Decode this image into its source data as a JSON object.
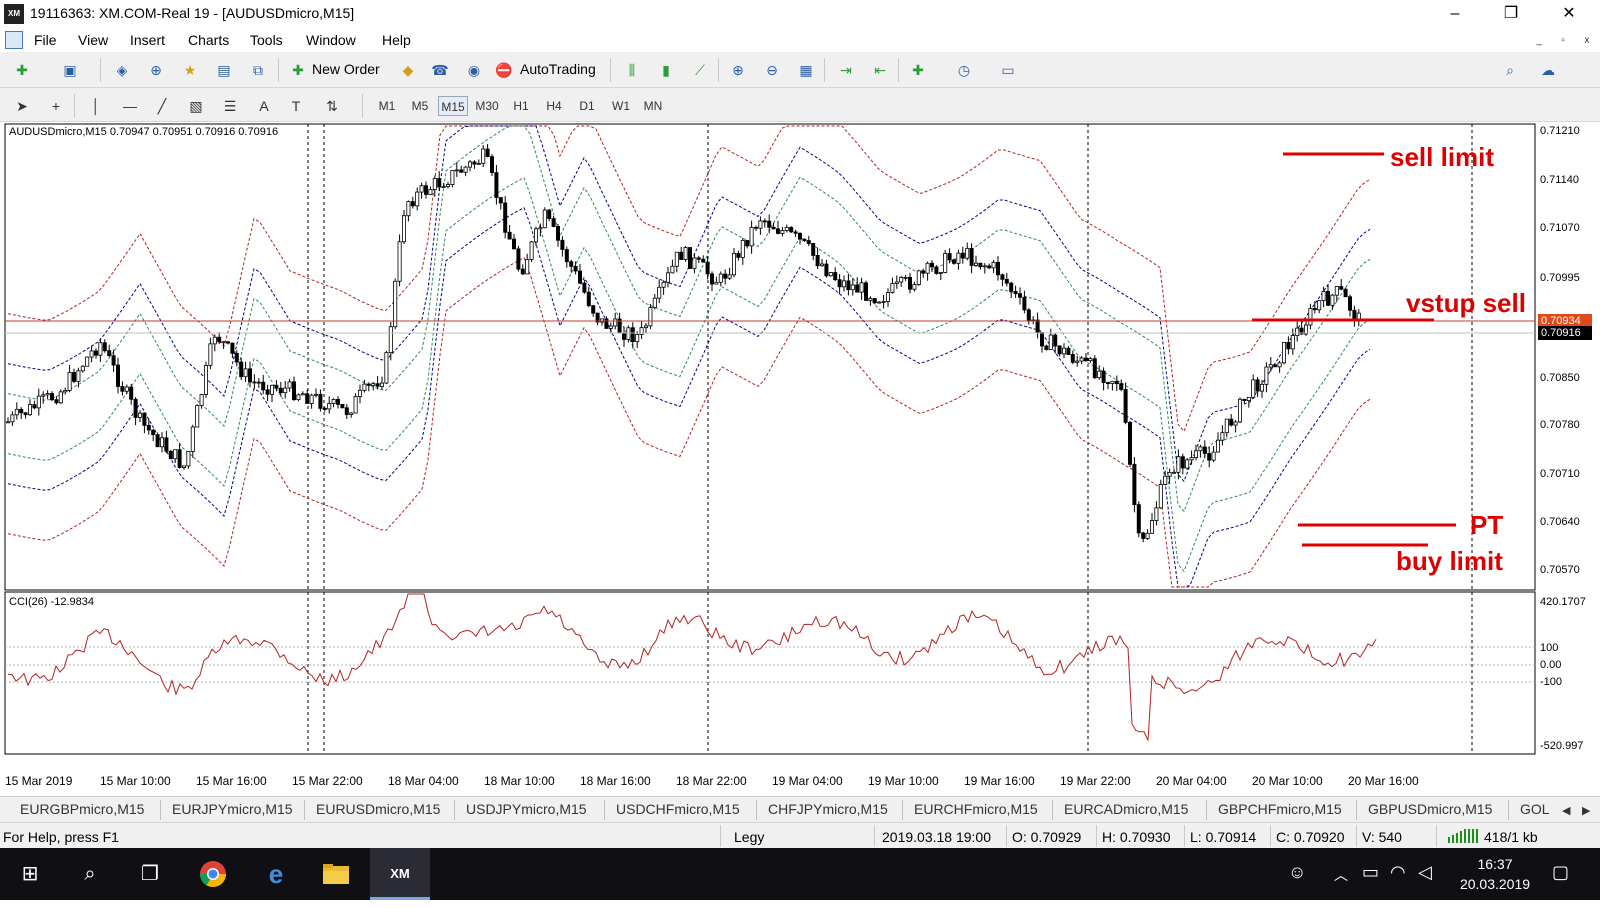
{
  "window": {
    "title": "19116363: XM.COM-Real 19 - [AUDUSDmicro,M15]",
    "app_logo": "XM",
    "controls": {
      "minimize": "–",
      "maximize": "❐",
      "close": "✕"
    }
  },
  "menu": {
    "items": [
      "File",
      "View",
      "Insert",
      "Charts",
      "Tools",
      "Window",
      "Help"
    ],
    "mdi_controls": {
      "minimize": "_",
      "restore": "▫",
      "close": "x"
    }
  },
  "toolbar": {
    "new_order_label": "New Order",
    "autotrading_label": "AutoTrading",
    "timeframes": [
      "M1",
      "M5",
      "M15",
      "M30",
      "H1",
      "H4",
      "D1",
      "W1",
      "MN"
    ],
    "active_timeframe": "M15",
    "text_tool_label": "A"
  },
  "chart": {
    "info_line": "AUDUSDmicro,M15  0.70947 0.70951 0.70916 0.70916",
    "cci_info": "CCI(26) -12.9834",
    "price_axis": [
      "0.71210",
      "0.71140",
      "0.71070",
      "0.70995",
      "0.70850",
      "0.70780",
      "0.70710",
      "0.70640",
      "0.70570"
    ],
    "current_price": "0.70916",
    "red_line_price": "0.70934",
    "cci_axis": [
      "420.1707",
      "100",
      "0.00",
      "-100",
      "-520.997"
    ],
    "time_axis": [
      "15 Mar 2019",
      "15 Mar 10:00",
      "15 Mar 16:00",
      "15 Mar 22:00",
      "18 Mar 04:00",
      "18 Mar 10:00",
      "18 Mar 16:00",
      "18 Mar 22:00",
      "19 Mar 04:00",
      "19 Mar 10:00",
      "19 Mar 16:00",
      "19 Mar 22:00",
      "20 Mar 04:00",
      "20 Mar 10:00",
      "20 Mar 16:00"
    ],
    "annotations": {
      "sell_limit": "sell limit",
      "vstup_sell": "vstup sell",
      "pt": "PT",
      "buy_limit": "buy limit"
    },
    "colors": {
      "candles": "#000000",
      "price_line": "#c0392b",
      "annotation": "#dd0000",
      "bands_blue": "#00008b",
      "bands_red": "#b22222",
      "bands_green": "#2e8b57",
      "cci": "#b22222"
    }
  },
  "symbol_tabs": [
    "EURGBPmicro,M15",
    "EURJPYmicro,M15",
    "EURUSDmicro,M15",
    "USDJPYmicro,M15",
    "USDCHFmicro,M15",
    "CHFJPYmicro,M15",
    "EURCHFmicro,M15",
    "EURCADmicro,M15",
    "GBPCHFmicro,M15",
    "GBPUSDmicro,M15",
    "GOL"
  ],
  "statusbar": {
    "help": "For Help, press F1",
    "profile": "Legy",
    "datetime": "2019.03.18 19:00",
    "open": "O: 0.70929",
    "high": "H: 0.70930",
    "low": "L: 0.70914",
    "close": "C: 0.70920",
    "volume": "V: 540",
    "traffic": "418/1 kb"
  },
  "taskbar": {
    "time": "16:37",
    "date": "20.03.2019",
    "active_app": "XM"
  }
}
